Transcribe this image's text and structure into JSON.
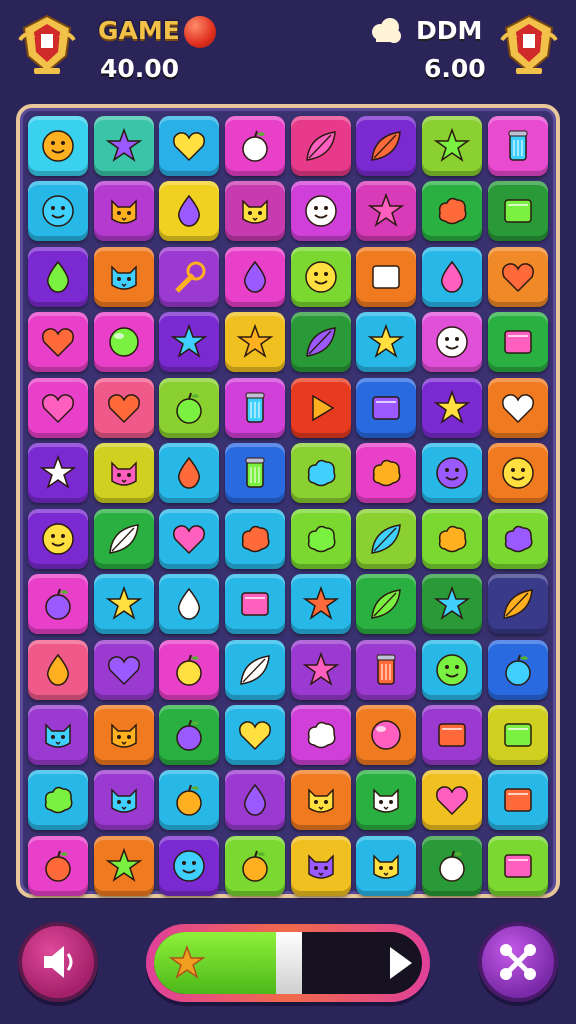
{
  "hud": {
    "left_label": "GAME",
    "left_score": "40.00",
    "right_label": "DDM",
    "right_score": "6.00"
  },
  "progress": {
    "fraction": 0.47
  },
  "board": {
    "rows": [
      [
        [
          "#3ad0f0",
          "face"
        ],
        [
          "#3ac4a8",
          "star"
        ],
        [
          "#2ab0e8",
          "heart"
        ],
        [
          "#e840c8",
          "fruit"
        ],
        [
          "#e83a8a",
          "leaf"
        ],
        [
          "#7a2ad0",
          "leaf"
        ],
        [
          "#8ad030",
          "star"
        ],
        [
          "#e84ad0",
          "can"
        ]
      ],
      [
        [
          "#28b8e8",
          "face"
        ],
        [
          "#b43ad0",
          "cat"
        ],
        [
          "#f0d020",
          "drop"
        ],
        [
          "#c83ab0",
          "cat"
        ],
        [
          "#d040d8",
          "face"
        ],
        [
          "#d83ab8",
          "star"
        ],
        [
          "#2ab040",
          "blob"
        ],
        [
          "#2a9a38",
          "box"
        ]
      ],
      [
        [
          "#7a2ad0",
          "drop"
        ],
        [
          "#f07a20",
          "cat"
        ],
        [
          "#9a3ad0",
          "wand"
        ],
        [
          "#e840c8",
          "drop"
        ],
        [
          "#7ad830",
          "face"
        ],
        [
          "#f07a20",
          "box"
        ],
        [
          "#28b8e8",
          "drop"
        ],
        [
          "#f08a28",
          "heart"
        ]
      ],
      [
        [
          "#e840c8",
          "heart"
        ],
        [
          "#e840c8",
          "ball"
        ],
        [
          "#7a2ad0",
          "star"
        ],
        [
          "#f0c020",
          "star"
        ],
        [
          "#2a9a38",
          "leaf"
        ],
        [
          "#28b8e8",
          "star"
        ],
        [
          "#e050d8",
          "face"
        ],
        [
          "#2ab040",
          "box"
        ]
      ],
      [
        [
          "#e840c8",
          "heart"
        ],
        [
          "#f05a8a",
          "heart"
        ],
        [
          "#8ad030",
          "fruit"
        ],
        [
          "#d040d8",
          "can"
        ],
        [
          "#e83a20",
          "play"
        ],
        [
          "#2a6ae0",
          "box"
        ],
        [
          "#7a2ad0",
          "star"
        ],
        [
          "#f07a20",
          "heart"
        ]
      ],
      [
        [
          "#7a2ad0",
          "star"
        ],
        [
          "#d0d020",
          "cat"
        ],
        [
          "#28b8e8",
          "drop"
        ],
        [
          "#2a6ae0",
          "can"
        ],
        [
          "#8ad030",
          "blob"
        ],
        [
          "#e840c8",
          "blob"
        ],
        [
          "#28b8e8",
          "face"
        ],
        [
          "#f07a20",
          "face"
        ]
      ],
      [
        [
          "#7a2ad0",
          "face"
        ],
        [
          "#2ab040",
          "leaf"
        ],
        [
          "#28b8e8",
          "heart"
        ],
        [
          "#28b8e8",
          "blob"
        ],
        [
          "#7ad830",
          "blob"
        ],
        [
          "#8ad030",
          "leaf"
        ],
        [
          "#7ad830",
          "blob"
        ],
        [
          "#7ad830",
          "blob"
        ]
      ],
      [
        [
          "#e840c8",
          "fruit"
        ],
        [
          "#28b8e8",
          "star"
        ],
        [
          "#28b8e8",
          "drop"
        ],
        [
          "#28b8e8",
          "box"
        ],
        [
          "#28b8e8",
          "star"
        ],
        [
          "#2ab040",
          "leaf"
        ],
        [
          "#2a9a38",
          "star"
        ],
        [
          "#3a3a8a",
          "leaf"
        ]
      ],
      [
        [
          "#f05a8a",
          "drop"
        ],
        [
          "#9a3ad0",
          "heart"
        ],
        [
          "#e840c8",
          "fruit"
        ],
        [
          "#28b8e8",
          "leaf"
        ],
        [
          "#9a3ad0",
          "star"
        ],
        [
          "#9a3ad0",
          "can"
        ],
        [
          "#28b8e8",
          "face"
        ],
        [
          "#2a6ae0",
          "fruit"
        ]
      ],
      [
        [
          "#9a3ad0",
          "cat"
        ],
        [
          "#f07a20",
          "cat"
        ],
        [
          "#2ab040",
          "fruit"
        ],
        [
          "#28b8e8",
          "heart"
        ],
        [
          "#d040d8",
          "blob"
        ],
        [
          "#f07a20",
          "ball"
        ],
        [
          "#9a3ad0",
          "box"
        ],
        [
          "#d0d020",
          "box"
        ]
      ],
      [
        [
          "#28b8e8",
          "blob"
        ],
        [
          "#9a3ad0",
          "cat"
        ],
        [
          "#28b8e8",
          "fruit"
        ],
        [
          "#9a3ad0",
          "drop"
        ],
        [
          "#f07a20",
          "cat"
        ],
        [
          "#2ab040",
          "cat"
        ],
        [
          "#f0c020",
          "heart"
        ],
        [
          "#28b8e8",
          "box"
        ]
      ],
      [
        [
          "#e840c8",
          "fruit"
        ],
        [
          "#f07a20",
          "star"
        ],
        [
          "#7a2ad0",
          "face"
        ],
        [
          "#7ad830",
          "fruit"
        ],
        [
          "#f0c020",
          "cat"
        ],
        [
          "#28b8e8",
          "cat"
        ],
        [
          "#2a9a38",
          "fruit"
        ],
        [
          "#7ad830",
          "box"
        ]
      ]
    ]
  }
}
